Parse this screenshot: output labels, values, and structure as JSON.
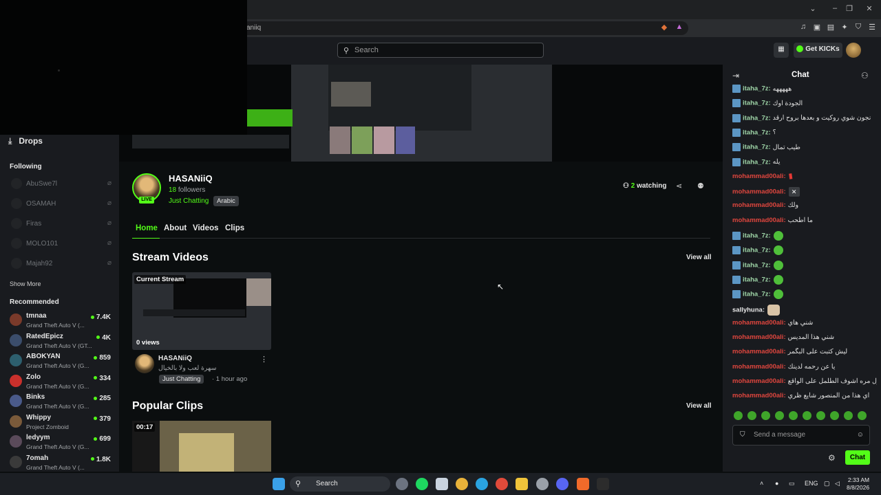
{
  "browser": {
    "url": "aniiq",
    "window_controls": [
      "minimize-icon",
      "restore-icon",
      "close-icon"
    ]
  },
  "header": {
    "search_placeholder": "Search",
    "get_kicks_label": "Get KICKs"
  },
  "sidebar": {
    "drops_label": "Drops",
    "following_header": "Following",
    "following": [
      "AbuSwe7l",
      "OSAMAH",
      "Firas",
      "MOLO101",
      "Majah92"
    ],
    "show_more": "Show More",
    "recommended_header": "Recommended",
    "recommended": [
      {
        "name": "tmnaa",
        "game": "Grand Theft Auto V (...",
        "viewers": "7.4K",
        "color": "#7a3a2a"
      },
      {
        "name": "RatedEpicz",
        "game": "Grand Theft Auto V (GT...",
        "viewers": "4K",
        "color": "#3b4d6b"
      },
      {
        "name": "ABOKYAN",
        "game": "Grand Theft Auto V (G...",
        "viewers": "859",
        "color": "#2d5f6e"
      },
      {
        "name": "Zolo",
        "game": "Grand Theft Auto V (G...",
        "viewers": "334",
        "color": "#c9302c"
      },
      {
        "name": "Binks",
        "game": "Grand Theft Auto V (G...",
        "viewers": "285",
        "color": "#4a5a8a"
      },
      {
        "name": "Whippy",
        "game": "Project Zomboid",
        "viewers": "379",
        "color": "#7a5a3a"
      },
      {
        "name": "ledyym",
        "game": "Grand Theft Auto V (G...",
        "viewers": "699",
        "color": "#5a4a5a"
      },
      {
        "name": "7omah",
        "game": "Grand Theft Auto V (...",
        "viewers": "1.8K",
        "color": "#3a3a3a"
      }
    ]
  },
  "channel": {
    "name": "HASANiiQ",
    "followers_count": "18",
    "followers_label": "followers",
    "category": "Just Chatting",
    "language": "Arabic",
    "live_badge": "LIVE",
    "watching_count": "2",
    "watching_label": "watching"
  },
  "tabs": [
    "Home",
    "About",
    "Videos",
    "Clips"
  ],
  "stream_videos": {
    "heading": "Stream Videos",
    "view_all": "View all",
    "card": {
      "tag": "Current Stream",
      "views": "0 views",
      "user": "HASANiiQ",
      "title": "سهرة لعب ولا بالخيال",
      "category": "Just Chatting",
      "ago": "· 1 hour ago"
    }
  },
  "popular_clips": {
    "heading": "Popular Clips",
    "view_all": "View all",
    "clip_duration": "00:17"
  },
  "chat": {
    "title": "Chat",
    "messages": [
      {
        "user": "itaha_7z:",
        "text": "هههههه",
        "color": "#9fd6a8",
        "badge": true,
        "extra": ""
      },
      {
        "user": "itaha_7z:",
        "text": "الجودة اوك",
        "color": "#9fd6a8",
        "badge": true,
        "extra": ""
      },
      {
        "user": "itaha_7z:",
        "text": "نجون شوي روكيت و بعدها بروح ارقد",
        "color": "#9fd6a8",
        "badge": true,
        "extra": ""
      },
      {
        "user": "itaha_7z:",
        "text": "؟",
        "color": "#9fd6a8",
        "badge": true,
        "extra": ""
      },
      {
        "user": "itaha_7z:",
        "text": "طيب تمال",
        "color": "#9fd6a8",
        "badge": true,
        "extra": ""
      },
      {
        "user": "itaha_7z:",
        "text": "يله",
        "color": "#9fd6a8",
        "badge": true,
        "extra": ""
      },
      {
        "user": "mohammad00ali:",
        "text": "",
        "color": "#e0463e",
        "badge": false,
        "extra": "bang"
      },
      {
        "user": "mohammad00ali:",
        "text": "",
        "color": "#e0463e",
        "badge": false,
        "extra": "mute"
      },
      {
        "user": "mohammad00ali:",
        "text": "ولك",
        "color": "#e0463e",
        "badge": false,
        "extra": ""
      },
      {
        "user": "mohammad00ali:",
        "text": "ما اطحب",
        "color": "#e0463e",
        "badge": false,
        "extra": ""
      },
      {
        "user": "itaha_7z:",
        "text": "",
        "color": "#9fd6a8",
        "badge": true,
        "extra": "emote"
      },
      {
        "user": "itaha_7z:",
        "text": "",
        "color": "#9fd6a8",
        "badge": true,
        "extra": "emote"
      },
      {
        "user": "itaha_7z:",
        "text": "",
        "color": "#9fd6a8",
        "badge": true,
        "extra": "emote"
      },
      {
        "user": "itaha_7z:",
        "text": "",
        "color": "#9fd6a8",
        "badge": true,
        "extra": "emote"
      },
      {
        "user": "itaha_7z:",
        "text": "",
        "color": "#9fd6a8",
        "badge": true,
        "extra": "emote"
      },
      {
        "user": "sallyhuna:",
        "text": "",
        "color": "#e8e8e8",
        "badge": false,
        "extra": "cat"
      },
      {
        "user": "mohammad00ali:",
        "text": "شني هاي",
        "color": "#e0463e",
        "badge": false,
        "extra": ""
      },
      {
        "user": "mohammad00ali:",
        "text": "شني هذا المديس",
        "color": "#e0463e",
        "badge": false,
        "extra": ""
      },
      {
        "user": "mohammad00ali:",
        "text": "ليش كتبت على البگمر",
        "color": "#e0463e",
        "badge": false,
        "extra": ""
      },
      {
        "user": "mohammad00ali:",
        "text": "يا عن رحمه لدينك",
        "color": "#e0463e",
        "badge": false,
        "extra": ""
      },
      {
        "user": "mohammad00ali:",
        "text": "اول مره اشوف الطلمل على الواقع",
        "color": "#e0463e",
        "badge": false,
        "extra": ""
      },
      {
        "user": "mohammad00ali:",
        "text": "اي هذا من المنصور شايع ظري",
        "color": "#e0463e",
        "badge": false,
        "extra": ""
      }
    ],
    "input_placeholder": "Send a message",
    "send_label": "Chat"
  },
  "taskbar": {
    "search_label": "Search",
    "lang": "ENG",
    "time": "2:33 AM",
    "date": "8/8/2026"
  },
  "colors": {
    "accent": "#53fc18",
    "bg": "#0b0e0f",
    "panel": "#191b1f"
  }
}
